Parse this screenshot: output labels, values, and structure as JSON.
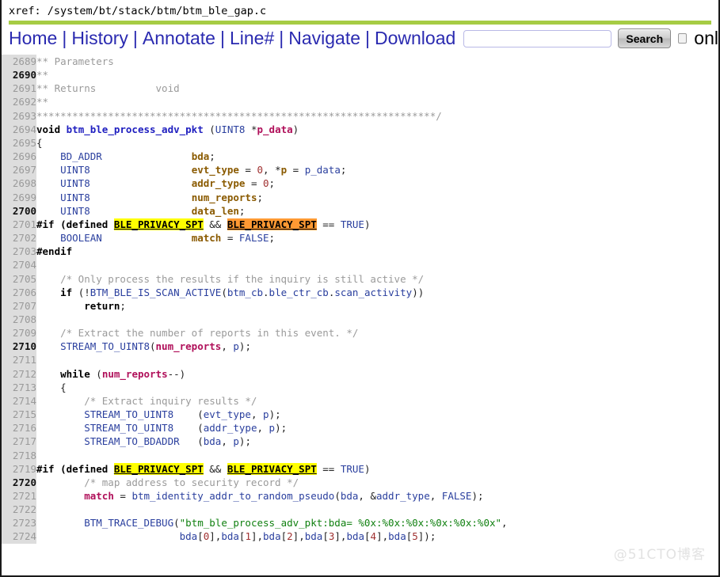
{
  "header": {
    "xref_label": "xref: /system/bt/stack/btm/btm_ble_gap.c",
    "accent_color": "#a6cc44"
  },
  "nav": {
    "links": [
      {
        "label": "Home",
        "name": "nav-home"
      },
      {
        "label": "History",
        "name": "nav-history"
      },
      {
        "label": "Annotate",
        "name": "nav-annotate"
      },
      {
        "label": "Line#",
        "name": "nav-linenumber"
      },
      {
        "label": "Navigate",
        "name": "nav-navigate"
      },
      {
        "label": "Download",
        "name": "nav-download"
      }
    ],
    "separator": "|",
    "search_value": "",
    "search_placeholder": "",
    "search_button": "Search",
    "checkbox_checked": false,
    "checkbox_label": "onl"
  },
  "code": {
    "first_line": 2689,
    "major_every": 10,
    "lines": [
      {
        "n": "2689",
        "tokens": [
          {
            "t": "** Parameters",
            "c": "c"
          }
        ]
      },
      {
        "n": "2690",
        "tokens": [
          {
            "t": "**",
            "c": "c"
          }
        ]
      },
      {
        "n": "2691",
        "tokens": [
          {
            "t": "** Returns          void",
            "c": "c"
          }
        ]
      },
      {
        "n": "2692",
        "tokens": [
          {
            "t": "**",
            "c": "c"
          }
        ]
      },
      {
        "n": "2693",
        "tokens": [
          {
            "t": "*******************************************************************/",
            "c": "c"
          }
        ]
      },
      {
        "n": "2694",
        "tokens": [
          {
            "t": "void ",
            "c": "kw"
          },
          {
            "t": "btm_ble_process_adv_pkt",
            "c": "fn"
          },
          {
            "t": " (",
            "c": "pl"
          },
          {
            "t": "UINT8",
            "c": "ty"
          },
          {
            "t": " *",
            "c": "pl"
          },
          {
            "t": "p_data",
            "c": "vr"
          },
          {
            "t": ")",
            "c": "pl"
          }
        ]
      },
      {
        "n": "2695",
        "tokens": [
          {
            "t": "{",
            "c": "pl"
          }
        ]
      },
      {
        "n": "2696",
        "tokens": [
          {
            "t": "    ",
            "c": "pl"
          },
          {
            "t": "BD_ADDR",
            "c": "ty"
          },
          {
            "t": "               ",
            "c": "pl"
          },
          {
            "t": "bda",
            "c": "vb"
          },
          {
            "t": ";",
            "c": "pl"
          }
        ]
      },
      {
        "n": "2697",
        "tokens": [
          {
            "t": "    ",
            "c": "pl"
          },
          {
            "t": "UINT8",
            "c": "ty"
          },
          {
            "t": "                 ",
            "c": "pl"
          },
          {
            "t": "evt_type",
            "c": "vb"
          },
          {
            "t": " = ",
            "c": "pl"
          },
          {
            "t": "0",
            "c": "nu"
          },
          {
            "t": ", *",
            "c": "pl"
          },
          {
            "t": "p",
            "c": "vb"
          },
          {
            "t": " = ",
            "c": "pl"
          },
          {
            "t": "p_data",
            "c": "ty"
          },
          {
            "t": ";",
            "c": "pl"
          }
        ]
      },
      {
        "n": "2698",
        "tokens": [
          {
            "t": "    ",
            "c": "pl"
          },
          {
            "t": "UINT8",
            "c": "ty"
          },
          {
            "t": "                 ",
            "c": "pl"
          },
          {
            "t": "addr_type",
            "c": "vb"
          },
          {
            "t": " = ",
            "c": "pl"
          },
          {
            "t": "0",
            "c": "nu"
          },
          {
            "t": ";",
            "c": "pl"
          }
        ]
      },
      {
        "n": "2699",
        "tokens": [
          {
            "t": "    ",
            "c": "pl"
          },
          {
            "t": "UINT8",
            "c": "ty"
          },
          {
            "t": "                 ",
            "c": "pl"
          },
          {
            "t": "num_reports",
            "c": "vb"
          },
          {
            "t": ";",
            "c": "pl"
          }
        ]
      },
      {
        "n": "2700",
        "tokens": [
          {
            "t": "    ",
            "c": "pl"
          },
          {
            "t": "UINT8",
            "c": "ty"
          },
          {
            "t": "                 ",
            "c": "pl"
          },
          {
            "t": "data_len",
            "c": "vb"
          },
          {
            "t": ";",
            "c": "pl"
          }
        ]
      },
      {
        "n": "2701",
        "tokens": [
          {
            "t": "#if (",
            "c": "pp"
          },
          {
            "t": "defined ",
            "c": "pp"
          },
          {
            "t": "BLE_PRIVACY_SPT",
            "c": "hl-y"
          },
          {
            "t": " && ",
            "c": "pl"
          },
          {
            "t": "BLE_PRIVACY_SPT",
            "c": "hl-o"
          },
          {
            "t": " == ",
            "c": "pl"
          },
          {
            "t": "TRUE",
            "c": "ty"
          },
          {
            "t": ")",
            "c": "pl"
          }
        ]
      },
      {
        "n": "2702",
        "tokens": [
          {
            "t": "    ",
            "c": "pl"
          },
          {
            "t": "BOOLEAN",
            "c": "ty"
          },
          {
            "t": "               ",
            "c": "pl"
          },
          {
            "t": "match",
            "c": "vb"
          },
          {
            "t": " = ",
            "c": "pl"
          },
          {
            "t": "FALSE",
            "c": "ty"
          },
          {
            "t": ";",
            "c": "pl"
          }
        ]
      },
      {
        "n": "2703",
        "tokens": [
          {
            "t": "#endif",
            "c": "pp"
          }
        ]
      },
      {
        "n": "2704",
        "tokens": [
          {
            "t": "",
            "c": "pl"
          }
        ]
      },
      {
        "n": "2705",
        "tokens": [
          {
            "t": "    /* Only process the results if the inquiry is still active */",
            "c": "c"
          }
        ]
      },
      {
        "n": "2706",
        "tokens": [
          {
            "t": "    ",
            "c": "pl"
          },
          {
            "t": "if",
            "c": "kw"
          },
          {
            "t": " (!",
            "c": "pl"
          },
          {
            "t": "BTM_BLE_IS_SCAN_ACTIVE",
            "c": "ty"
          },
          {
            "t": "(",
            "c": "pl"
          },
          {
            "t": "btm_cb",
            "c": "ty"
          },
          {
            "t": ".",
            "c": "pl"
          },
          {
            "t": "ble_ctr_cb",
            "c": "ty"
          },
          {
            "t": ".",
            "c": "pl"
          },
          {
            "t": "scan_activity",
            "c": "ty"
          },
          {
            "t": "))",
            "c": "pl"
          }
        ]
      },
      {
        "n": "2707",
        "tokens": [
          {
            "t": "        ",
            "c": "pl"
          },
          {
            "t": "return",
            "c": "kw"
          },
          {
            "t": ";",
            "c": "pl"
          }
        ]
      },
      {
        "n": "2708",
        "tokens": [
          {
            "t": "",
            "c": "pl"
          }
        ]
      },
      {
        "n": "2709",
        "tokens": [
          {
            "t": "    /* Extract the number of reports in this event. */",
            "c": "c"
          }
        ]
      },
      {
        "n": "2710",
        "tokens": [
          {
            "t": "    ",
            "c": "pl"
          },
          {
            "t": "STREAM_TO_UINT8",
            "c": "ty"
          },
          {
            "t": "(",
            "c": "pl"
          },
          {
            "t": "num_reports",
            "c": "vr"
          },
          {
            "t": ", ",
            "c": "pl"
          },
          {
            "t": "p",
            "c": "ty"
          },
          {
            "t": ");",
            "c": "pl"
          }
        ]
      },
      {
        "n": "2711",
        "tokens": [
          {
            "t": "",
            "c": "pl"
          }
        ]
      },
      {
        "n": "2712",
        "tokens": [
          {
            "t": "    ",
            "c": "pl"
          },
          {
            "t": "while",
            "c": "kw"
          },
          {
            "t": " (",
            "c": "pl"
          },
          {
            "t": "num_reports",
            "c": "vr"
          },
          {
            "t": "--)",
            "c": "pl"
          }
        ]
      },
      {
        "n": "2713",
        "tokens": [
          {
            "t": "    {",
            "c": "pl"
          }
        ]
      },
      {
        "n": "2714",
        "tokens": [
          {
            "t": "        /* Extract inquiry results */",
            "c": "c"
          }
        ]
      },
      {
        "n": "2715",
        "tokens": [
          {
            "t": "        ",
            "c": "pl"
          },
          {
            "t": "STREAM_TO_UINT8",
            "c": "ty"
          },
          {
            "t": "    (",
            "c": "pl"
          },
          {
            "t": "evt_type",
            "c": "ty"
          },
          {
            "t": ", ",
            "c": "pl"
          },
          {
            "t": "p",
            "c": "ty"
          },
          {
            "t": ");",
            "c": "pl"
          }
        ]
      },
      {
        "n": "2716",
        "tokens": [
          {
            "t": "        ",
            "c": "pl"
          },
          {
            "t": "STREAM_TO_UINT8",
            "c": "ty"
          },
          {
            "t": "    (",
            "c": "pl"
          },
          {
            "t": "addr_type",
            "c": "ty"
          },
          {
            "t": ", ",
            "c": "pl"
          },
          {
            "t": "p",
            "c": "ty"
          },
          {
            "t": ");",
            "c": "pl"
          }
        ]
      },
      {
        "n": "2717",
        "tokens": [
          {
            "t": "        ",
            "c": "pl"
          },
          {
            "t": "STREAM_TO_BDADDR",
            "c": "ty"
          },
          {
            "t": "   (",
            "c": "pl"
          },
          {
            "t": "bda",
            "c": "ty"
          },
          {
            "t": ", ",
            "c": "pl"
          },
          {
            "t": "p",
            "c": "ty"
          },
          {
            "t": ");",
            "c": "pl"
          }
        ]
      },
      {
        "n": "2718",
        "tokens": [
          {
            "t": "",
            "c": "pl"
          }
        ]
      },
      {
        "n": "2719",
        "tokens": [
          {
            "t": "#if (",
            "c": "pp"
          },
          {
            "t": "defined ",
            "c": "pp"
          },
          {
            "t": "BLE_PRIVACY_SPT",
            "c": "hl-y"
          },
          {
            "t": " && ",
            "c": "pl"
          },
          {
            "t": "BLE_PRIVACY_SPT",
            "c": "hl-y"
          },
          {
            "t": " == ",
            "c": "pl"
          },
          {
            "t": "TRUE",
            "c": "ty"
          },
          {
            "t": ")",
            "c": "pl"
          }
        ]
      },
      {
        "n": "2720",
        "tokens": [
          {
            "t": "        /* map address to security record */",
            "c": "c"
          }
        ]
      },
      {
        "n": "2721",
        "tokens": [
          {
            "t": "        ",
            "c": "pl"
          },
          {
            "t": "match",
            "c": "vr"
          },
          {
            "t": " = ",
            "c": "pl"
          },
          {
            "t": "btm_identity_addr_to_random_pseudo",
            "c": "ty"
          },
          {
            "t": "(",
            "c": "pl"
          },
          {
            "t": "bda",
            "c": "ty"
          },
          {
            "t": ", &",
            "c": "pl"
          },
          {
            "t": "addr_type",
            "c": "ty"
          },
          {
            "t": ", ",
            "c": "pl"
          },
          {
            "t": "FALSE",
            "c": "ty"
          },
          {
            "t": ");",
            "c": "pl"
          }
        ]
      },
      {
        "n": "2722",
        "tokens": [
          {
            "t": "",
            "c": "pl"
          }
        ]
      },
      {
        "n": "2723",
        "tokens": [
          {
            "t": "        ",
            "c": "pl"
          },
          {
            "t": "BTM_TRACE_DEBUG",
            "c": "ty"
          },
          {
            "t": "(",
            "c": "pl"
          },
          {
            "t": "\"btm_ble_process_adv_pkt:bda= %0x:%0x:%0x:%0x:%0x:%0x\"",
            "c": "st"
          },
          {
            "t": ",",
            "c": "pl"
          }
        ]
      },
      {
        "n": "2724",
        "tokens": [
          {
            "t": "                        ",
            "c": "pl"
          },
          {
            "t": "bda",
            "c": "ty"
          },
          {
            "t": "[",
            "c": "pl"
          },
          {
            "t": "0",
            "c": "nu"
          },
          {
            "t": "],",
            "c": "pl"
          },
          {
            "t": "bda",
            "c": "ty"
          },
          {
            "t": "[",
            "c": "pl"
          },
          {
            "t": "1",
            "c": "nu"
          },
          {
            "t": "],",
            "c": "pl"
          },
          {
            "t": "bda",
            "c": "ty"
          },
          {
            "t": "[",
            "c": "pl"
          },
          {
            "t": "2",
            "c": "nu"
          },
          {
            "t": "],",
            "c": "pl"
          },
          {
            "t": "bda",
            "c": "ty"
          },
          {
            "t": "[",
            "c": "pl"
          },
          {
            "t": "3",
            "c": "nu"
          },
          {
            "t": "],",
            "c": "pl"
          },
          {
            "t": "bda",
            "c": "ty"
          },
          {
            "t": "[",
            "c": "pl"
          },
          {
            "t": "4",
            "c": "nu"
          },
          {
            "t": "],",
            "c": "pl"
          },
          {
            "t": "bda",
            "c": "ty"
          },
          {
            "t": "[",
            "c": "pl"
          },
          {
            "t": "5",
            "c": "nu"
          },
          {
            "t": "]);",
            "c": "pl"
          }
        ]
      }
    ]
  },
  "watermark": {
    "text": "@51CTO博客"
  }
}
